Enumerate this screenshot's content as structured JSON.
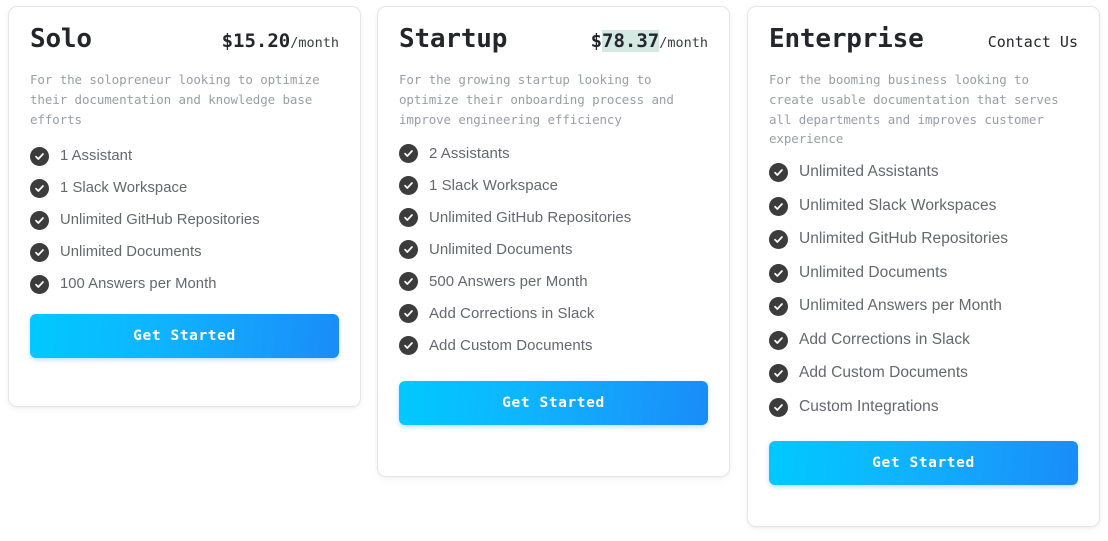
{
  "theme": {
    "card_background": "#ffffff",
    "card_border": "#e6e6e6",
    "title_color": "#24262b",
    "description_color": "#9a9ea4",
    "feature_text_color": "#64676d",
    "check_icon_background": "#3c3c3c",
    "check_icon_glyph": "#ffffff",
    "price_highlight_background": "#d4e9e2",
    "cta_gradient_from": "#00c9ff",
    "cta_gradient_to": "#1a8cf8",
    "cta_text_color": "#ffffff"
  },
  "plans": [
    {
      "id": "solo",
      "title": "Solo",
      "price": {
        "currency": "$",
        "amount": "15.20",
        "period": "/month",
        "highlighted": false
      },
      "contact_label": null,
      "description": "For the solopreneur looking to optimize their documentation and knowledge base efforts",
      "features": [
        "1 Assistant",
        "1 Slack Workspace",
        "Unlimited GitHub Repositories",
        "Unlimited Documents",
        "100 Answers per Month"
      ],
      "cta_label": "Get Started"
    },
    {
      "id": "startup",
      "title": "Startup",
      "price": {
        "currency": "$",
        "amount": "78.37",
        "period": "/month",
        "highlighted": true
      },
      "contact_label": null,
      "description": "For the growing startup looking to optimize their onboarding process and improve engineering efficiency",
      "features": [
        "2 Assistants",
        "1 Slack Workspace",
        "Unlimited GitHub Repositories",
        "Unlimited Documents",
        "500 Answers per Month",
        "Add Corrections in Slack",
        "Add Custom Documents"
      ],
      "cta_label": "Get Started"
    },
    {
      "id": "enterprise",
      "title": "Enterprise",
      "price": null,
      "contact_label": "Contact Us",
      "description": "For the booming business looking to create usable documentation that serves all departments and improves customer experience",
      "features": [
        "Unlimited Assistants",
        "Unlimited Slack Workspaces",
        "Unlimited GitHub Repositories",
        "Unlimited Documents",
        "Unlimited Answers per Month",
        "Add Corrections in Slack",
        "Add Custom Documents",
        "Custom Integrations"
      ],
      "cta_label": "Get Started"
    }
  ],
  "icons": {
    "check": "check-circle-icon"
  }
}
